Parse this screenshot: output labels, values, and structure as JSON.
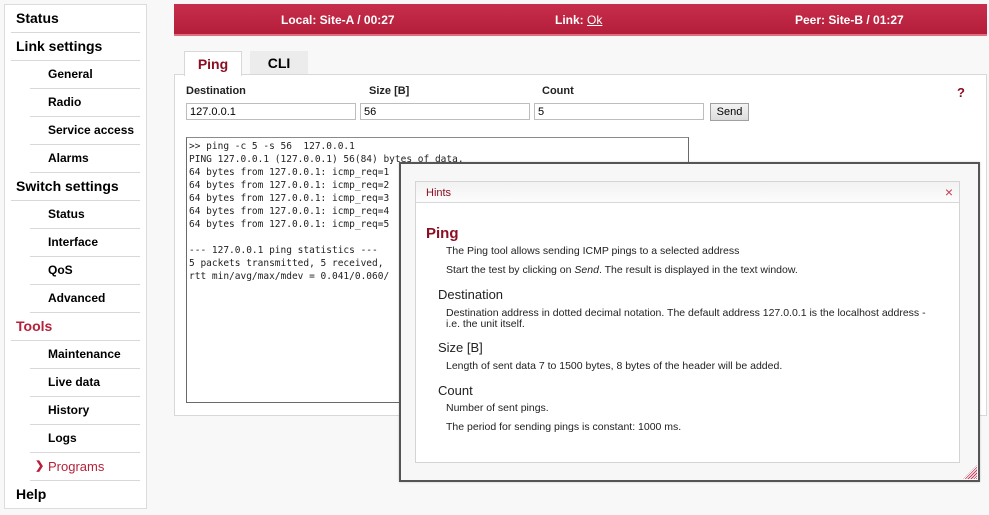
{
  "sidebar": {
    "groups": [
      {
        "label": "Status",
        "items": []
      },
      {
        "label": "Link settings",
        "items": [
          "General",
          "Radio",
          "Service access",
          "Alarms"
        ]
      },
      {
        "label": "Switch settings",
        "items": [
          "Status",
          "Interface",
          "QoS",
          "Advanced"
        ]
      },
      {
        "label": "Tools",
        "active": true,
        "items": [
          "Maintenance",
          "Live data",
          "History",
          "Logs",
          "Programs"
        ]
      },
      {
        "label": "Help",
        "items": []
      }
    ],
    "active_item": "Programs",
    "active_color": "#b5213a"
  },
  "topbar": {
    "local_label": "Local: Site-A / 00:27",
    "link_prefix": "Link: ",
    "link_value": "Ok",
    "peer_label": "Peer: Site-B / 01:27",
    "color": "#c0283f"
  },
  "tabs": {
    "ping": "Ping",
    "cli": "CLI",
    "active": "Ping"
  },
  "form": {
    "destination_label": "Destination",
    "destination_value": "127.0.0.1",
    "size_label": "Size [B]",
    "size_value": "56",
    "count_label": "Count",
    "count_value": "5",
    "send_label": "Send",
    "help_label": "?"
  },
  "output": {
    "lines": [
      ">> ping -c 5 -s 56  127.0.0.1",
      "PING 127.0.0.1 (127.0.0.1) 56(84) bytes of data.",
      "64 bytes from 127.0.0.1: icmp_req=1",
      "64 bytes from 127.0.0.1: icmp_req=2",
      "64 bytes from 127.0.0.1: icmp_req=3",
      "64 bytes from 127.0.0.1: icmp_req=4",
      "64 bytes from 127.0.0.1: icmp_req=5",
      "",
      "--- 127.0.0.1 ping statistics ---",
      "5 packets transmitted, 5 received,",
      "rtt min/avg/max/mdev = 0.041/0.060/"
    ]
  },
  "hints": {
    "title": "Hints",
    "close_icon": "×",
    "ping_heading": "Ping",
    "ping_text1": "The Ping tool allows sending ICMP pings to a selected address",
    "ping_text2_pre": "Start the test by clicking on ",
    "ping_text2_em": "Send",
    "ping_text2_post": ". The result is displayed in the text window.",
    "destination_heading": "Destination",
    "destination_text": "Destination address in dotted decimal notation. The default address 127.0.0.1 is the localhost address - i.e. the unit itself.",
    "size_heading": "Size [B]",
    "size_text": "Length of sent data 7 to 1500 bytes, 8 bytes of the header will be added.",
    "count_heading": "Count",
    "count_text1": "Number of sent pings.",
    "count_text2": "The period for sending pings is constant: 1000 ms."
  }
}
